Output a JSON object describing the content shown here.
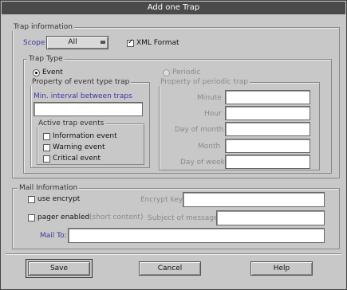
{
  "window": {
    "title": "Add one Trap"
  },
  "trap_info": {
    "legend": "Trap information",
    "scope_label": "Scope",
    "scope_value": "All",
    "xml_format_label": "XML Format",
    "xml_format_checked": true,
    "trap_type": {
      "legend": "Trap Type",
      "event_label": "Event",
      "periodic_label": "Periodic",
      "event_selected": true
    },
    "event_property": {
      "legend": "Property of event type trap",
      "min_interval_label": "Min. interval between traps",
      "min_interval_value": "",
      "active_trap_events": {
        "legend": "Active trap events",
        "items": [
          {
            "label": "Information event",
            "checked": false
          },
          {
            "label": "Warning event",
            "checked": false
          },
          {
            "label": "Critical event",
            "checked": false
          }
        ]
      }
    },
    "periodic_property": {
      "legend": "Property of periodic trap",
      "fields": [
        {
          "label": "Minute",
          "value": ""
        },
        {
          "label": "Hour",
          "value": ""
        },
        {
          "label": "Day of month",
          "value": ""
        },
        {
          "label": "Month",
          "value": ""
        },
        {
          "label": "Day of week",
          "value": ""
        }
      ]
    }
  },
  "mail_info": {
    "legend": "Mail Information",
    "use_encrypt_label": "use encrypt",
    "use_encrypt_checked": false,
    "encrypt_key_label": "Encrypt key:",
    "encrypt_key_value": "",
    "pager_label": "pager enabled",
    "pager_suffix": "(short content)",
    "pager_checked": false,
    "subject_label": "Subject of message:",
    "subject_value": "",
    "mail_to_label": "Mail To:",
    "mail_to_value": ""
  },
  "buttons": {
    "save": "Save",
    "cancel": "Cancel",
    "help": "Help"
  }
}
